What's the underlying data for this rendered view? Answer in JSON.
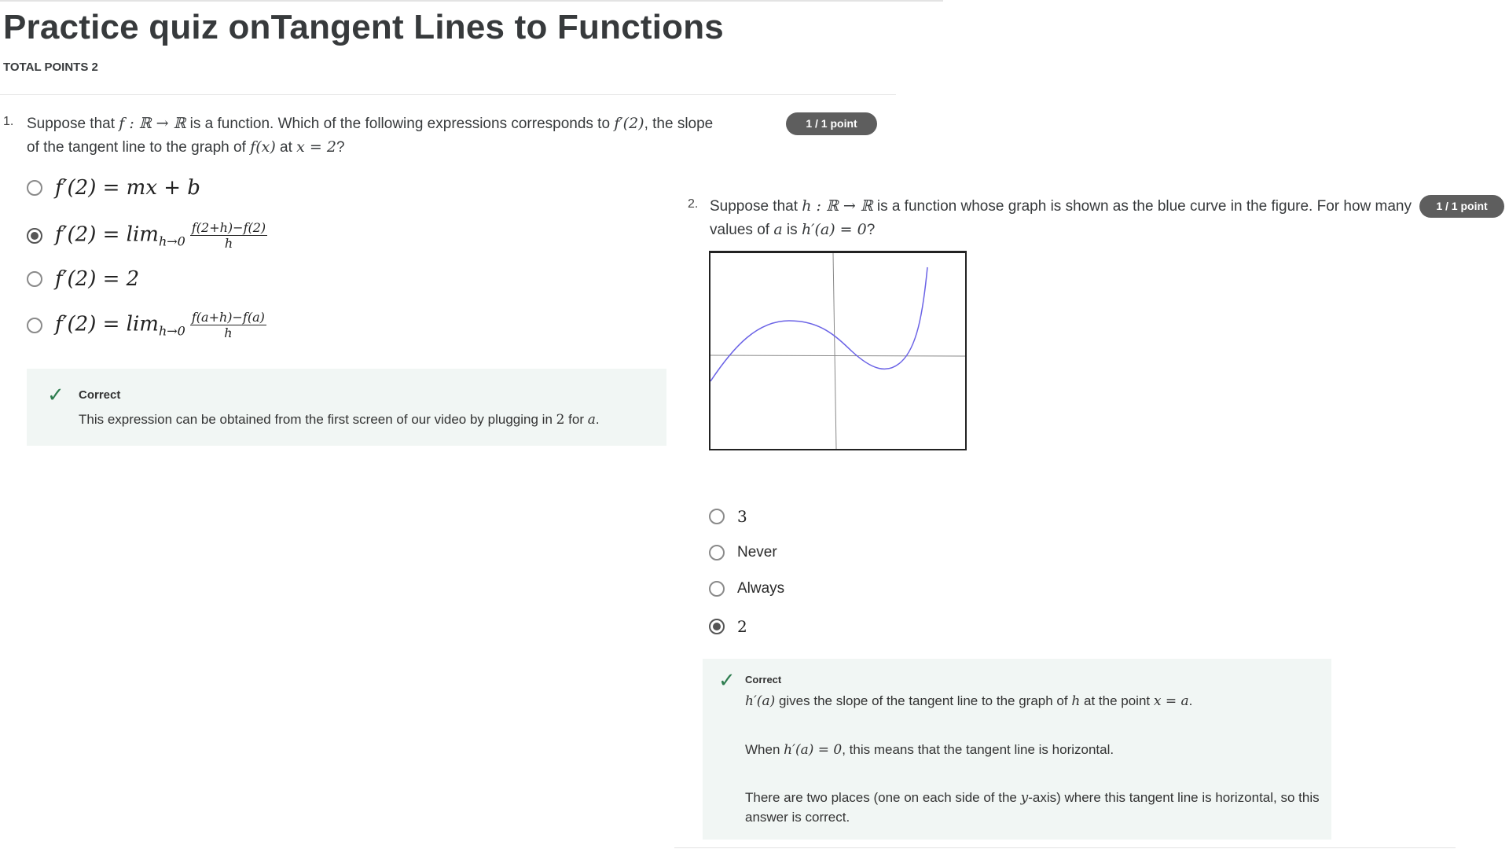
{
  "page": {
    "title": "Practice quiz onTangent Lines to Functions",
    "total_points": "TOTAL POINTS 2"
  },
  "q1": {
    "number": "1.",
    "text_a": "Suppose that ",
    "text_b": " is a function. Which of the following expressions corresponds to ",
    "text_c": ", the slope",
    "text_d": "of the tangent line to the graph of ",
    "text_e": " at ",
    "text_f": "?",
    "math_f": "f : ℝ → ℝ",
    "math_fp2": "f′(2)",
    "math_fx": "f(x)",
    "math_x2": "x = 2",
    "badge": "1 / 1 point",
    "options": [
      {
        "lhs": "f′(2) = mx + b",
        "selected": false
      },
      {
        "lhs": "f′(2) = lim",
        "sub": "h→0",
        "num": "f(2+h)−f(2)",
        "den": "h",
        "selected": true
      },
      {
        "lhs": "f′(2) = 2",
        "selected": false
      },
      {
        "lhs": "f′(2) = lim",
        "sub": "h→0",
        "num": "f(a+h)−f(a)",
        "den": "h",
        "selected": false
      }
    ],
    "feedback": {
      "title": "Correct",
      "text_a": "This expression can be obtained from the first screen of our video by plugging in ",
      "math_2": "2",
      "text_b": " for ",
      "math_a": "a",
      "text_c": "."
    }
  },
  "q2": {
    "number": "2.",
    "text_a": "Suppose that ",
    "math_h": "h : ℝ → ℝ",
    "text_b": " is a function whose graph is shown as the blue curve in the figure. For how many",
    "text_c": "values of ",
    "math_a": "a",
    "text_d": " is ",
    "math_hpa": "h′(a) = 0",
    "text_e": "?",
    "badge": "1 / 1 point",
    "graph": {
      "curve_color": "#6b63e6",
      "axis_color": "#888888"
    },
    "options": [
      {
        "label": "3",
        "selected": false,
        "math": true
      },
      {
        "label": "Never",
        "selected": false,
        "math": false
      },
      {
        "label": "Always",
        "selected": false,
        "math": false
      },
      {
        "label": "2",
        "selected": true,
        "math": true
      }
    ],
    "feedback": {
      "title": "Correct",
      "p1_math": "h′(a)",
      "p1_text_a": " gives the slope of the tangent line to the graph of ",
      "p1_math_h": "h",
      "p1_text_b": " at the point ",
      "p1_math_xa": "x = a",
      "p1_text_c": ".",
      "p2_text_a": "When ",
      "p2_math": "h′(a) = 0",
      "p2_text_b": ", this means that the tangent line is horizontal.",
      "p3_text_a": "There are two places (one on each side of the ",
      "p3_math": "y",
      "p3_text_b": "-axis) where this tangent line is horizontal, so this",
      "p3_text_c": "answer is correct."
    }
  }
}
